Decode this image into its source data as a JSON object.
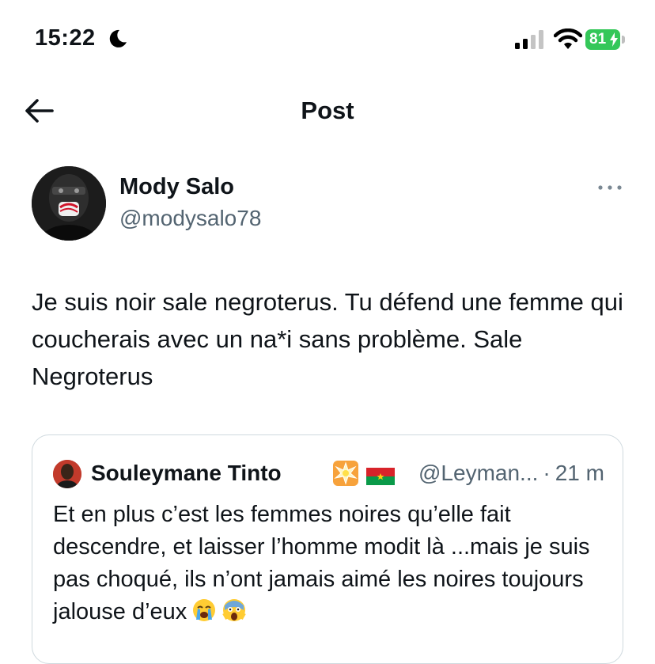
{
  "status_bar": {
    "time": "15:22",
    "battery": "81",
    "battery_color": "#34c759"
  },
  "nav": {
    "back_icon": "arrow-left-icon",
    "title": "Post"
  },
  "post": {
    "author_name": "Mody Salo",
    "author_handle": "@modysalo78",
    "more_icon": "more-horizontal-icon",
    "text": "Je suis noir sale negroterus. Tu défend une femme qui coucherais avec un na*i sans problème. Sale Negroterus"
  },
  "quote": {
    "author_name": "Souleymane Tinto",
    "name_emoji": "collision-emoji",
    "flag_icon": "burkina-faso-flag-icon",
    "handle": "@Leyman...",
    "separator": "·",
    "time": "21 m",
    "text": "Et en plus c’est les femmes noires qu’elle fait descendre, et laisser l’homme modit là ...mais je suis pas choqué, ils n’ont jamais aimé les noires toujours jalouse d’eux",
    "trailing_emojis": [
      "loudly-crying-face-emoji",
      "screaming-face-emoji"
    ]
  }
}
